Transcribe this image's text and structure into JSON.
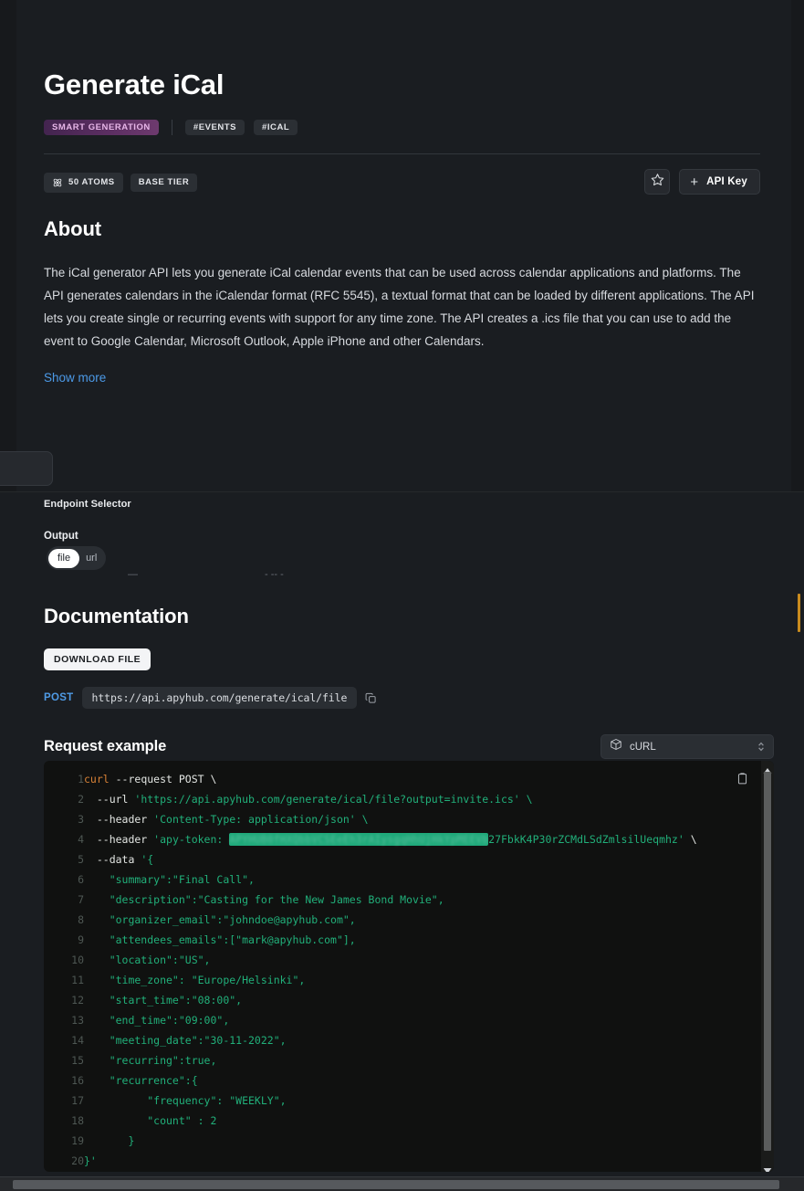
{
  "header": {
    "title": "Generate iCal",
    "tags": [
      {
        "label": "SMART GENERATION",
        "style": "smart"
      },
      {
        "label": "#EVENTS",
        "style": "plain"
      },
      {
        "label": "#ICAL",
        "style": "plain"
      }
    ],
    "atoms_label": "50 ATOMS",
    "tier_label": "BASE TIER",
    "favorite_icon": "star-icon",
    "api_key_button": {
      "plus": "+",
      "label": "API Key"
    }
  },
  "about": {
    "heading": "About",
    "body": "The iCal generator API lets you generate iCal calendar events that can be used across calendar applications and platforms. The API generates calendars in the iCalendar format (RFC 5545), a textual format that can be loaded by different applications. The API lets you create single or recurring events with support for any time zone. The API creates a .ics file that you can use to add the event to Google Calendar, Microsoft Outlook, Apple iPhone and other Calendars.",
    "show_more": "Show more"
  },
  "endpoint": {
    "selector_label": "Endpoint Selector",
    "output_label": "Output",
    "options": [
      "file",
      "url"
    ],
    "selected": "file"
  },
  "documentation": {
    "heading": "Documentation",
    "download_button": "DOWNLOAD FILE",
    "method": "POST",
    "url": "https://api.apyhub.com/generate/ical/file",
    "copy_icon": "copy-icon",
    "request_example_heading": "Request example",
    "language_select": {
      "value": "cURL",
      "icon": "package-icon"
    }
  },
  "code": {
    "copy_icon": "copy-icon",
    "lines": [
      {
        "n": "1",
        "text": "curl --request POST \\"
      },
      {
        "n": "2",
        "text": "  --url 'https://api.apyhub.com/generate/ical/file?output=invite.ics' \\"
      },
      {
        "n": "3",
        "text": "  --header 'Content-Type: application/json' \\"
      },
      {
        "n": "4",
        "text": "  --header 'apy-token: [REDACTED]27FbkK4P30rZCMdLSdZmlsilUeqmhz' \\"
      },
      {
        "n": "5",
        "text": "  --data '{"
      },
      {
        "n": "6",
        "text": "    \"summary\":\"Final Call\","
      },
      {
        "n": "7",
        "text": "    \"description\":\"Casting for the New James Bond Movie\","
      },
      {
        "n": "8",
        "text": "    \"organizer_email\":\"johndoe@apyhub.com\","
      },
      {
        "n": "9",
        "text": "    \"attendees_emails\":[\"mark@apyhub.com\"],"
      },
      {
        "n": "10",
        "text": "    \"location\":\"US\","
      },
      {
        "n": "11",
        "text": "    \"time_zone\": \"Europe/Helsinki\","
      },
      {
        "n": "12",
        "text": "    \"start_time\":\"08:00\","
      },
      {
        "n": "13",
        "text": "    \"end_time\":\"09:00\","
      },
      {
        "n": "14",
        "text": "    \"meeting_date\":\"30-11-2022\","
      },
      {
        "n": "15",
        "text": "    \"recurring\":true,"
      },
      {
        "n": "16",
        "text": "    \"recurrence\":{"
      },
      {
        "n": "17",
        "text": "          \"frequency\": \"WEEKLY\","
      },
      {
        "n": "18",
        "text": "          \"count\" : 2"
      },
      {
        "n": "19",
        "text": "       }"
      },
      {
        "n": "20",
        "text": "}'"
      }
    ],
    "token_visible_suffix": "27FbkK4P30rZCMdLSdZmlsilUeqmhz",
    "redacted_token_placeholder": "APYHUB0fHXQbbVCSEeEh3rAIysgqHhUjHkYpMEEVb"
  },
  "colors": {
    "background": "#1a1d21",
    "code_background": "#101110",
    "code_text": "#21b07a",
    "accent_link": "#4c9ae8",
    "method": "#4f9be6",
    "smart_badge_text": "#e7b6e8",
    "redaction": "#1fa97a",
    "right_marker": "#c98b1e"
  }
}
